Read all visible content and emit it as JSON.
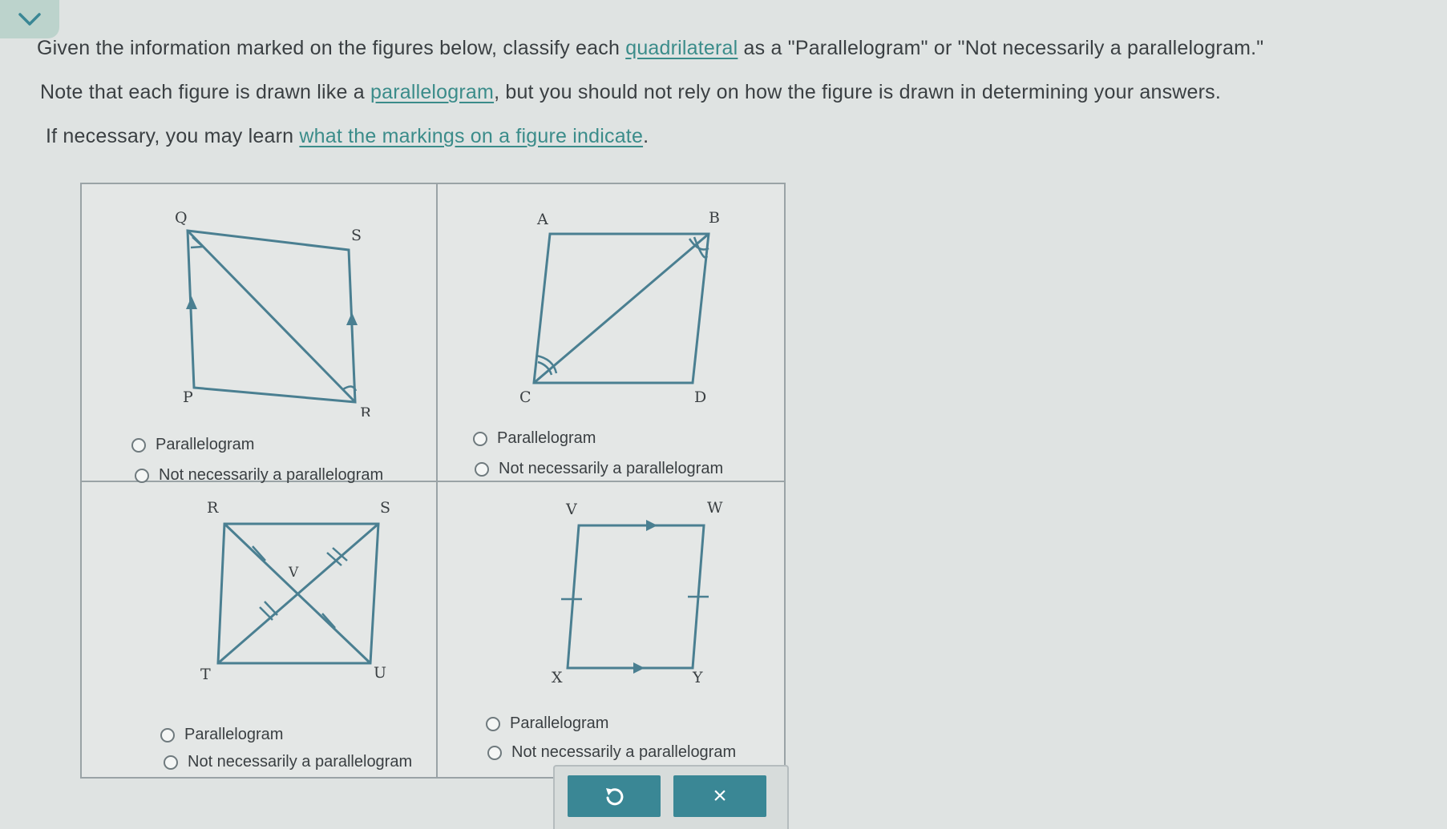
{
  "prompt": {
    "line1_pre": "Given the information marked on the figures below, classify each ",
    "line1_link": "quadrilateral",
    "line1_post": " as a \"Parallelogram\" or \"Not necessarily a parallelogram.\"",
    "line2_pre": "Note that each figure is drawn like a ",
    "line2_link": "parallelogram",
    "line2_post": ", but you should not rely on how the figure is drawn in determining your answers.",
    "line3_pre": "If necessary, you may learn ",
    "line3_link": "what the markings on a figure indicate",
    "line3_post": "."
  },
  "figures": [
    {
      "vertices": [
        "Q",
        "S",
        "P",
        "R"
      ],
      "options": [
        "Parallelogram",
        "Not necessarily a parallelogram"
      ]
    },
    {
      "vertices": [
        "A",
        "B",
        "C",
        "D"
      ],
      "options": [
        "Parallelogram",
        "Not necessarily a parallelogram"
      ]
    },
    {
      "vertices": [
        "R",
        "S",
        "V",
        "T",
        "U"
      ],
      "options": [
        "Parallelogram",
        "Not necessarily a parallelogram"
      ]
    },
    {
      "vertices": [
        "V",
        "W",
        "X",
        "Y"
      ],
      "options": [
        "Parallelogram",
        "Not necessarily a parallelogram"
      ]
    }
  ],
  "buttons": {
    "reset_icon": "undo-icon",
    "close_label": "×"
  },
  "colors": {
    "accent": "#3a8795",
    "figure_stroke": "#4a7f91",
    "link": "#3b8c8a"
  }
}
